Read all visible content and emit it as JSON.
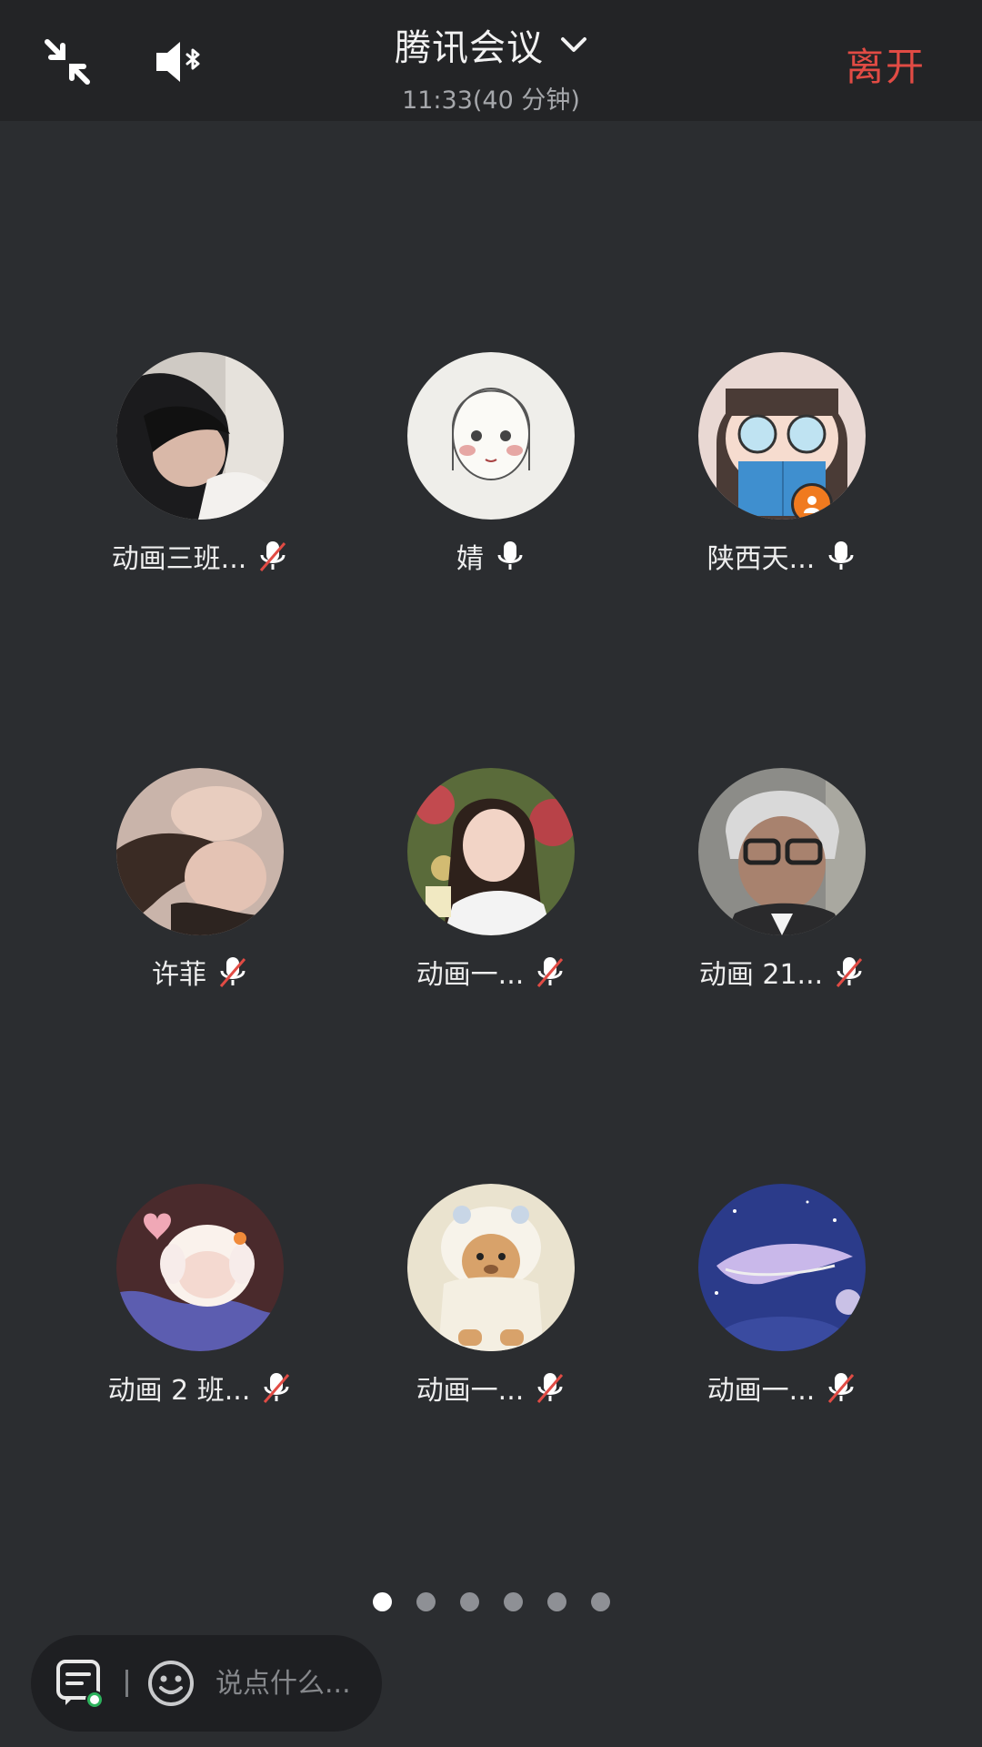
{
  "header": {
    "collapse_icon": "collapse-arrows-icon",
    "speaker_icon": "bluetooth-speaker-icon",
    "title": "腾讯会议",
    "title_dropdown_icon": "chevron-down-icon",
    "subtitle": "11:33(40 分钟)",
    "leave_label": "离开",
    "leave_color": "#e14b44"
  },
  "members": [
    {
      "name": "动画三班...",
      "mic": "muted"
    },
    {
      "name": "婧",
      "mic": "on"
    },
    {
      "name": "陕西天...",
      "mic": "on",
      "host": true
    },
    {
      "name": "许菲",
      "mic": "muted"
    },
    {
      "name": "动画一...",
      "mic": "muted"
    },
    {
      "name": "动画 21...",
      "mic": "muted"
    },
    {
      "name": "动画 2 班...",
      "mic": "muted"
    },
    {
      "name": "动画一...",
      "mic": "muted"
    },
    {
      "name": "动画一...",
      "mic": "muted"
    }
  ],
  "pagination": {
    "total": 6,
    "current": 1
  },
  "chat": {
    "list_icon": "chat-list-icon",
    "emoji_icon": "emoji-icon",
    "placeholder": "说点什么..."
  }
}
